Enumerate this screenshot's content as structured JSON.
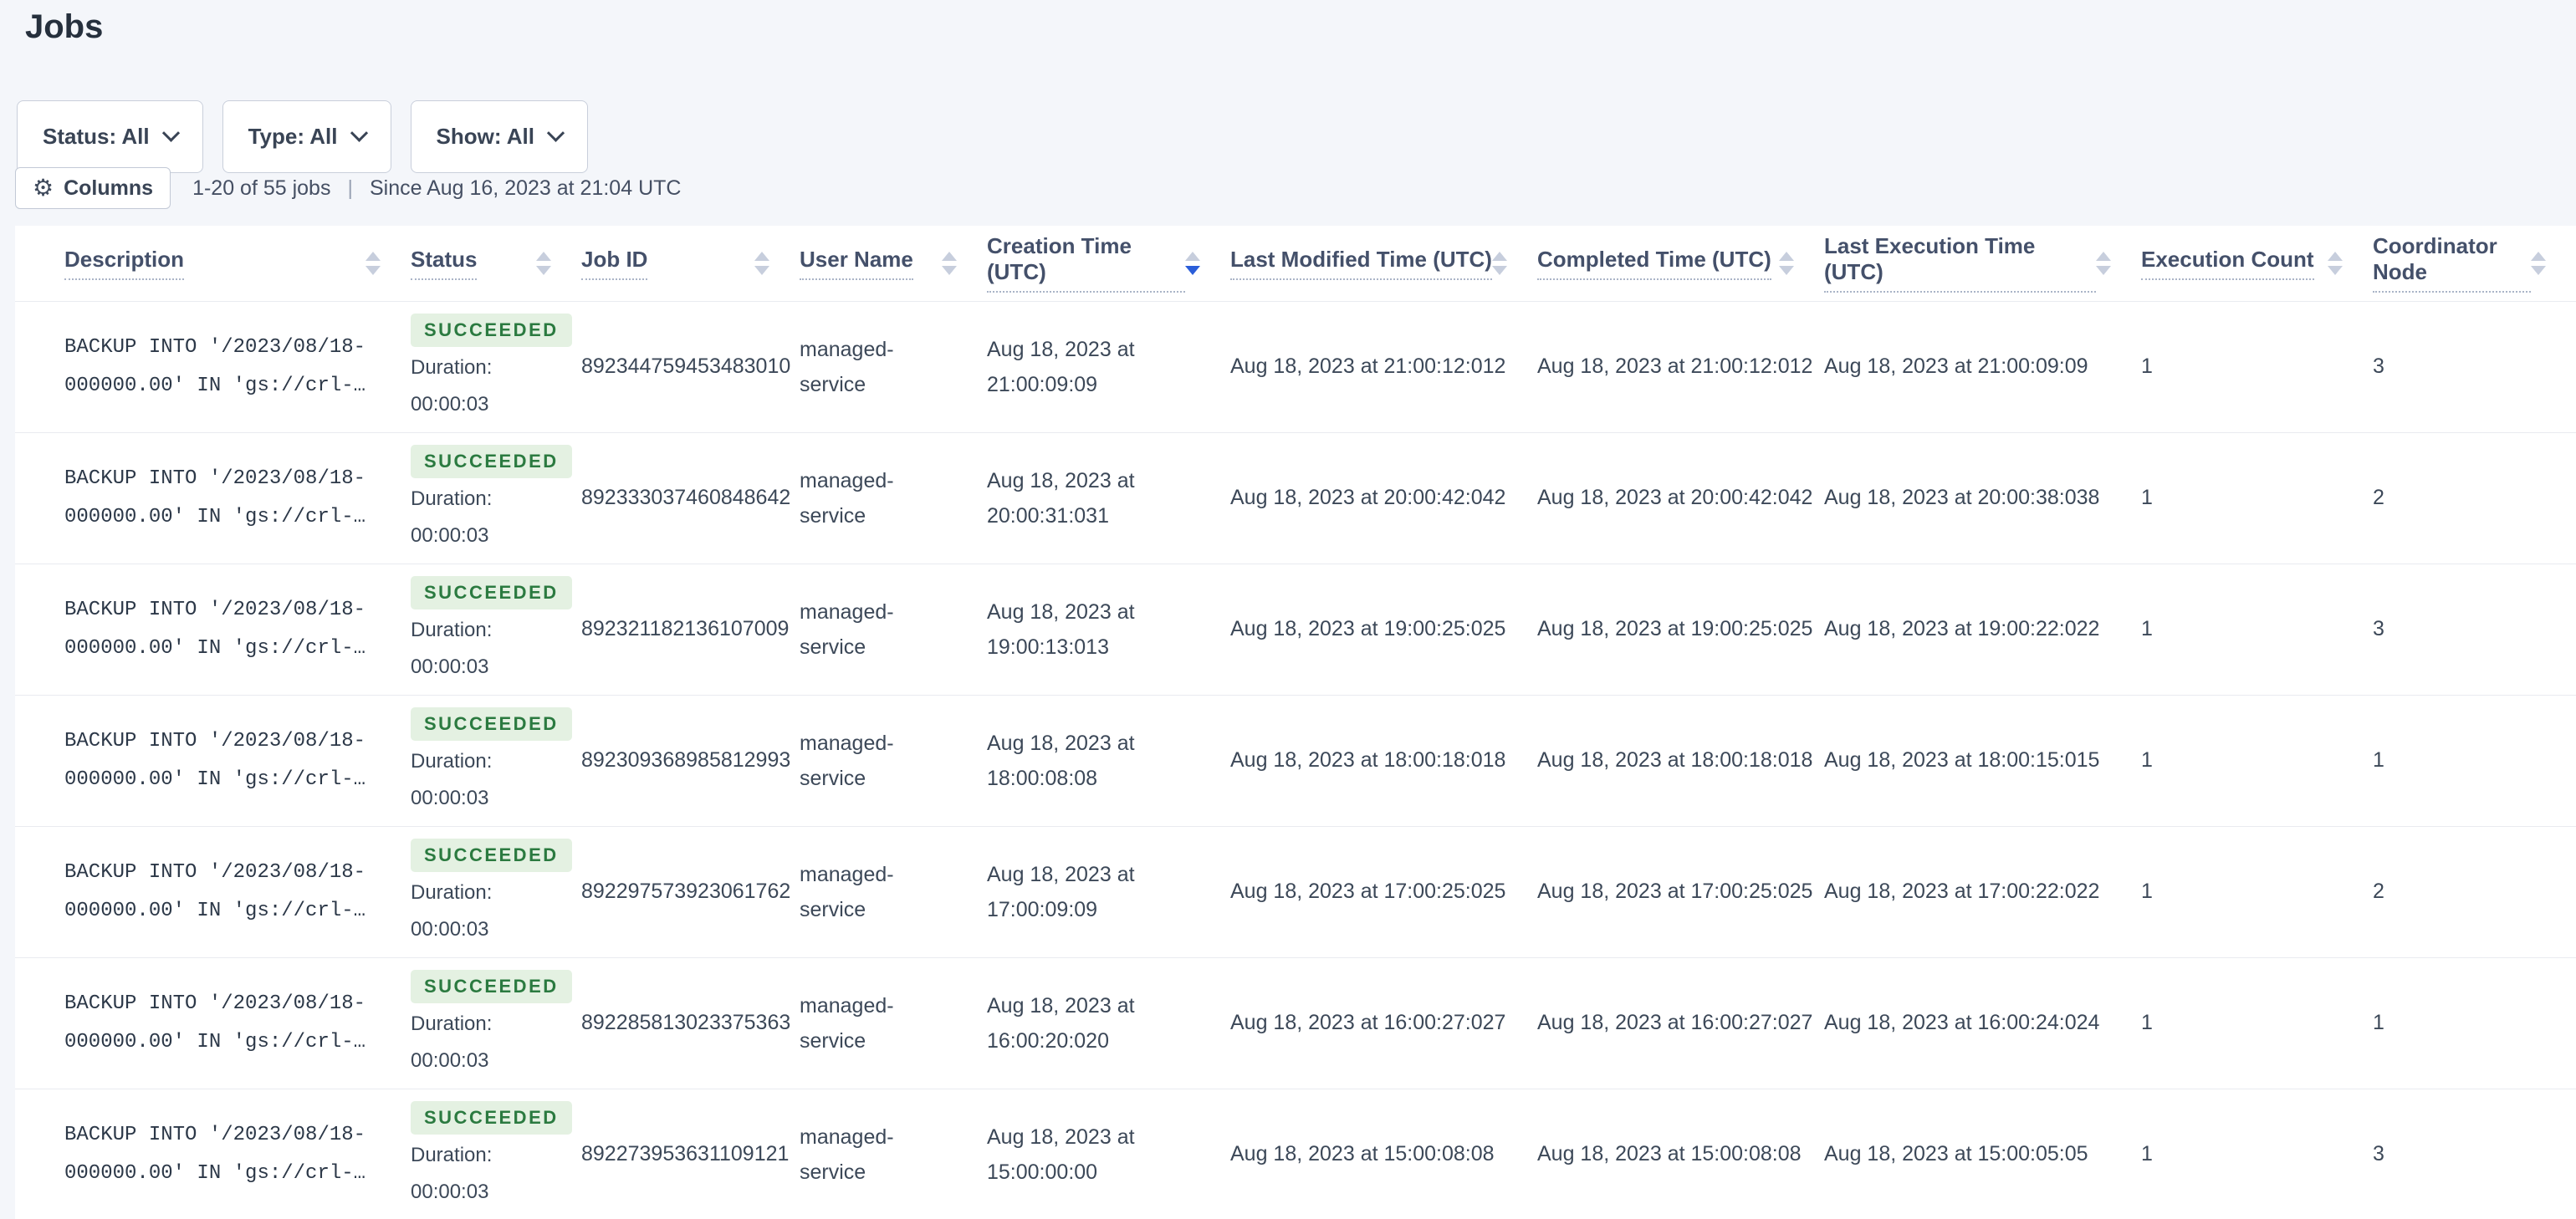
{
  "page": {
    "title": "Jobs"
  },
  "filters": [
    {
      "label": "Status: All"
    },
    {
      "label": "Type: All"
    },
    {
      "label": "Show: All"
    }
  ],
  "toolbar": {
    "columns_button": "Columns",
    "count_text": "1-20 of 55 jobs",
    "separator": "|",
    "since_text": "Since Aug 16, 2023 at 21:04 UTC"
  },
  "table": {
    "headers": [
      "Description",
      "Status",
      "Job ID",
      "User Name",
      "Creation Time (UTC)",
      "Last Modified Time (UTC)",
      "Completed Time (UTC)",
      "Last Execution Time (UTC)",
      "Execution Count",
      "Coordinator Node"
    ],
    "sort": {
      "column": "Creation Time (UTC)",
      "column_index": 4,
      "direction": "desc"
    },
    "rows": [
      {
        "description": "BACKUP INTO '/2023/08/18-000000.00' IN 'gs://crl-…",
        "status": "SUCCEEDED",
        "duration_label": "Duration:",
        "duration": "00:00:03",
        "job_id": "892344759453483010",
        "user_name": "managed-service",
        "creation_time": "Aug 18, 2023 at 21:00:09:09",
        "last_modified_time": "Aug 18, 2023 at 21:00:12:012",
        "completed_time": "Aug 18, 2023 at 21:00:12:012",
        "last_execution_time": "Aug 18, 2023 at 21:00:09:09",
        "execution_count": "1",
        "coordinator_node": "3"
      },
      {
        "description": "BACKUP INTO '/2023/08/18-000000.00' IN 'gs://crl-…",
        "status": "SUCCEEDED",
        "duration_label": "Duration:",
        "duration": "00:00:03",
        "job_id": "892333037460848642",
        "user_name": "managed-service",
        "creation_time": "Aug 18, 2023 at 20:00:31:031",
        "last_modified_time": "Aug 18, 2023 at 20:00:42:042",
        "completed_time": "Aug 18, 2023 at 20:00:42:042",
        "last_execution_time": "Aug 18, 2023 at 20:00:38:038",
        "execution_count": "1",
        "coordinator_node": "2"
      },
      {
        "description": "BACKUP INTO '/2023/08/18-000000.00' IN 'gs://crl-…",
        "status": "SUCCEEDED",
        "duration_label": "Duration:",
        "duration": "00:00:03",
        "job_id": "892321182136107009",
        "user_name": "managed-service",
        "creation_time": "Aug 18, 2023 at 19:00:13:013",
        "last_modified_time": "Aug 18, 2023 at 19:00:25:025",
        "completed_time": "Aug 18, 2023 at 19:00:25:025",
        "last_execution_time": "Aug 18, 2023 at 19:00:22:022",
        "execution_count": "1",
        "coordinator_node": "3"
      },
      {
        "description": "BACKUP INTO '/2023/08/18-000000.00' IN 'gs://crl-…",
        "status": "SUCCEEDED",
        "duration_label": "Duration:",
        "duration": "00:00:03",
        "job_id": "892309368985812993",
        "user_name": "managed-service",
        "creation_time": "Aug 18, 2023 at 18:00:08:08",
        "last_modified_time": "Aug 18, 2023 at 18:00:18:018",
        "completed_time": "Aug 18, 2023 at 18:00:18:018",
        "last_execution_time": "Aug 18, 2023 at 18:00:15:015",
        "execution_count": "1",
        "coordinator_node": "1"
      },
      {
        "description": "BACKUP INTO '/2023/08/18-000000.00' IN 'gs://crl-…",
        "status": "SUCCEEDED",
        "duration_label": "Duration:",
        "duration": "00:00:03",
        "job_id": "892297573923061762",
        "user_name": "managed-service",
        "creation_time": "Aug 18, 2023 at 17:00:09:09",
        "last_modified_time": "Aug 18, 2023 at 17:00:25:025",
        "completed_time": "Aug 18, 2023 at 17:00:25:025",
        "last_execution_time": "Aug 18, 2023 at 17:00:22:022",
        "execution_count": "1",
        "coordinator_node": "2"
      },
      {
        "description": "BACKUP INTO '/2023/08/18-000000.00' IN 'gs://crl-…",
        "status": "SUCCEEDED",
        "duration_label": "Duration:",
        "duration": "00:00:03",
        "job_id": "892285813023375363",
        "user_name": "managed-service",
        "creation_time": "Aug 18, 2023 at 16:00:20:020",
        "last_modified_time": "Aug 18, 2023 at 16:00:27:027",
        "completed_time": "Aug 18, 2023 at 16:00:27:027",
        "last_execution_time": "Aug 18, 2023 at 16:00:24:024",
        "execution_count": "1",
        "coordinator_node": "1"
      },
      {
        "description": "BACKUP INTO '/2023/08/18-000000.00' IN 'gs://crl-…",
        "status": "SUCCEEDED",
        "duration_label": "Duration:",
        "duration": "00:00:03",
        "job_id": "892273953631109121",
        "user_name": "managed-service",
        "creation_time": "Aug 18, 2023 at 15:00:00:00",
        "last_modified_time": "Aug 18, 2023 at 15:00:08:08",
        "completed_time": "Aug 18, 2023 at 15:00:08:08",
        "last_execution_time": "Aug 18, 2023 at 15:00:05:05",
        "execution_count": "1",
        "coordinator_node": "3"
      }
    ]
  },
  "colors": {
    "page_bg": "#f4f6fa",
    "accent_sort_arrow": "#2b5ed9",
    "badge_bg": "#e4f1e2",
    "badge_text": "#2b7a40"
  }
}
